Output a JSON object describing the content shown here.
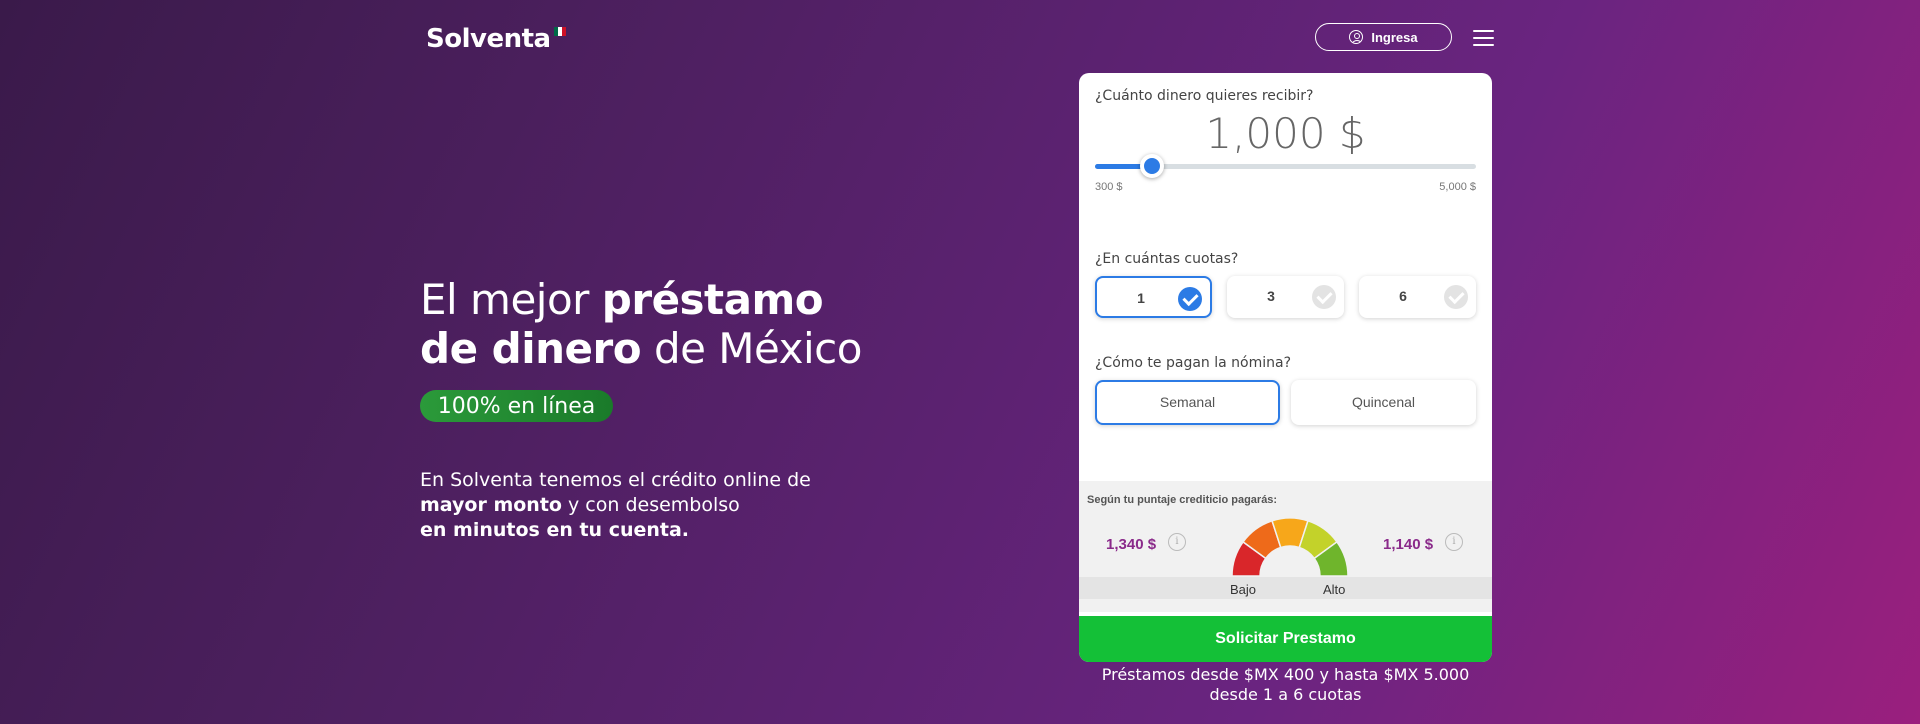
{
  "brand": {
    "name": "Solventa",
    "flag_colors": [
      "#006847",
      "#ffffff",
      "#ce1126"
    ]
  },
  "header": {
    "login_label": "Ingresa",
    "menu_icon": "hamburger-menu-icon"
  },
  "hero": {
    "title_line1_normal": "El mejor ",
    "title_line1_bold": "préstamo",
    "title_line2_bold": "de dinero",
    "title_line2_normal": " de México",
    "badge": "100% en línea",
    "desc_line1": "En Solventa tenemos el crédito online de",
    "desc_line2_bold": "mayor monto",
    "desc_line2_normal": " y con desembolso",
    "desc_line3_bold": "en minutos en tu cuenta."
  },
  "calculator": {
    "amount_question": "¿Cuánto dinero quieres recibir?",
    "amount_value": "1,000 $",
    "slider": {
      "min": 300,
      "max": 5000,
      "value": 1000,
      "min_label": "300 $",
      "max_label": "5,000 $"
    },
    "cuotas_question": "¿En cuántas cuotas?",
    "cuotas_options": [
      "1",
      "3",
      "6"
    ],
    "cuotas_selected": "1",
    "payroll_question": "¿Cómo te pagan la nómina?",
    "payroll_options": [
      "Semanal",
      "Quincenal"
    ],
    "payroll_selected": "Semanal",
    "score_label": "Según tu puntaje crediticio pagarás:",
    "score_low_value": "1,340 $",
    "score_high_value": "1,140 $",
    "gauge_low_label": "Bajo",
    "gauge_high_label": "Alto",
    "gauge_colors": [
      "#d9262a",
      "#ee6a1a",
      "#f7a71a",
      "#c3d22a",
      "#6fb52c"
    ],
    "submit_label": "Solicitar Prestamo"
  },
  "footer_note": {
    "line1": "Préstamos desde $MX 400 y hasta $MX 5.000",
    "line2": "desde 1 a 6 cuotas"
  },
  "colors": {
    "accent_blue": "#2c7be5",
    "cta_green": "#14c037",
    "price_purple": "#8a2a8a",
    "badge_green": "#2b9a3a"
  }
}
